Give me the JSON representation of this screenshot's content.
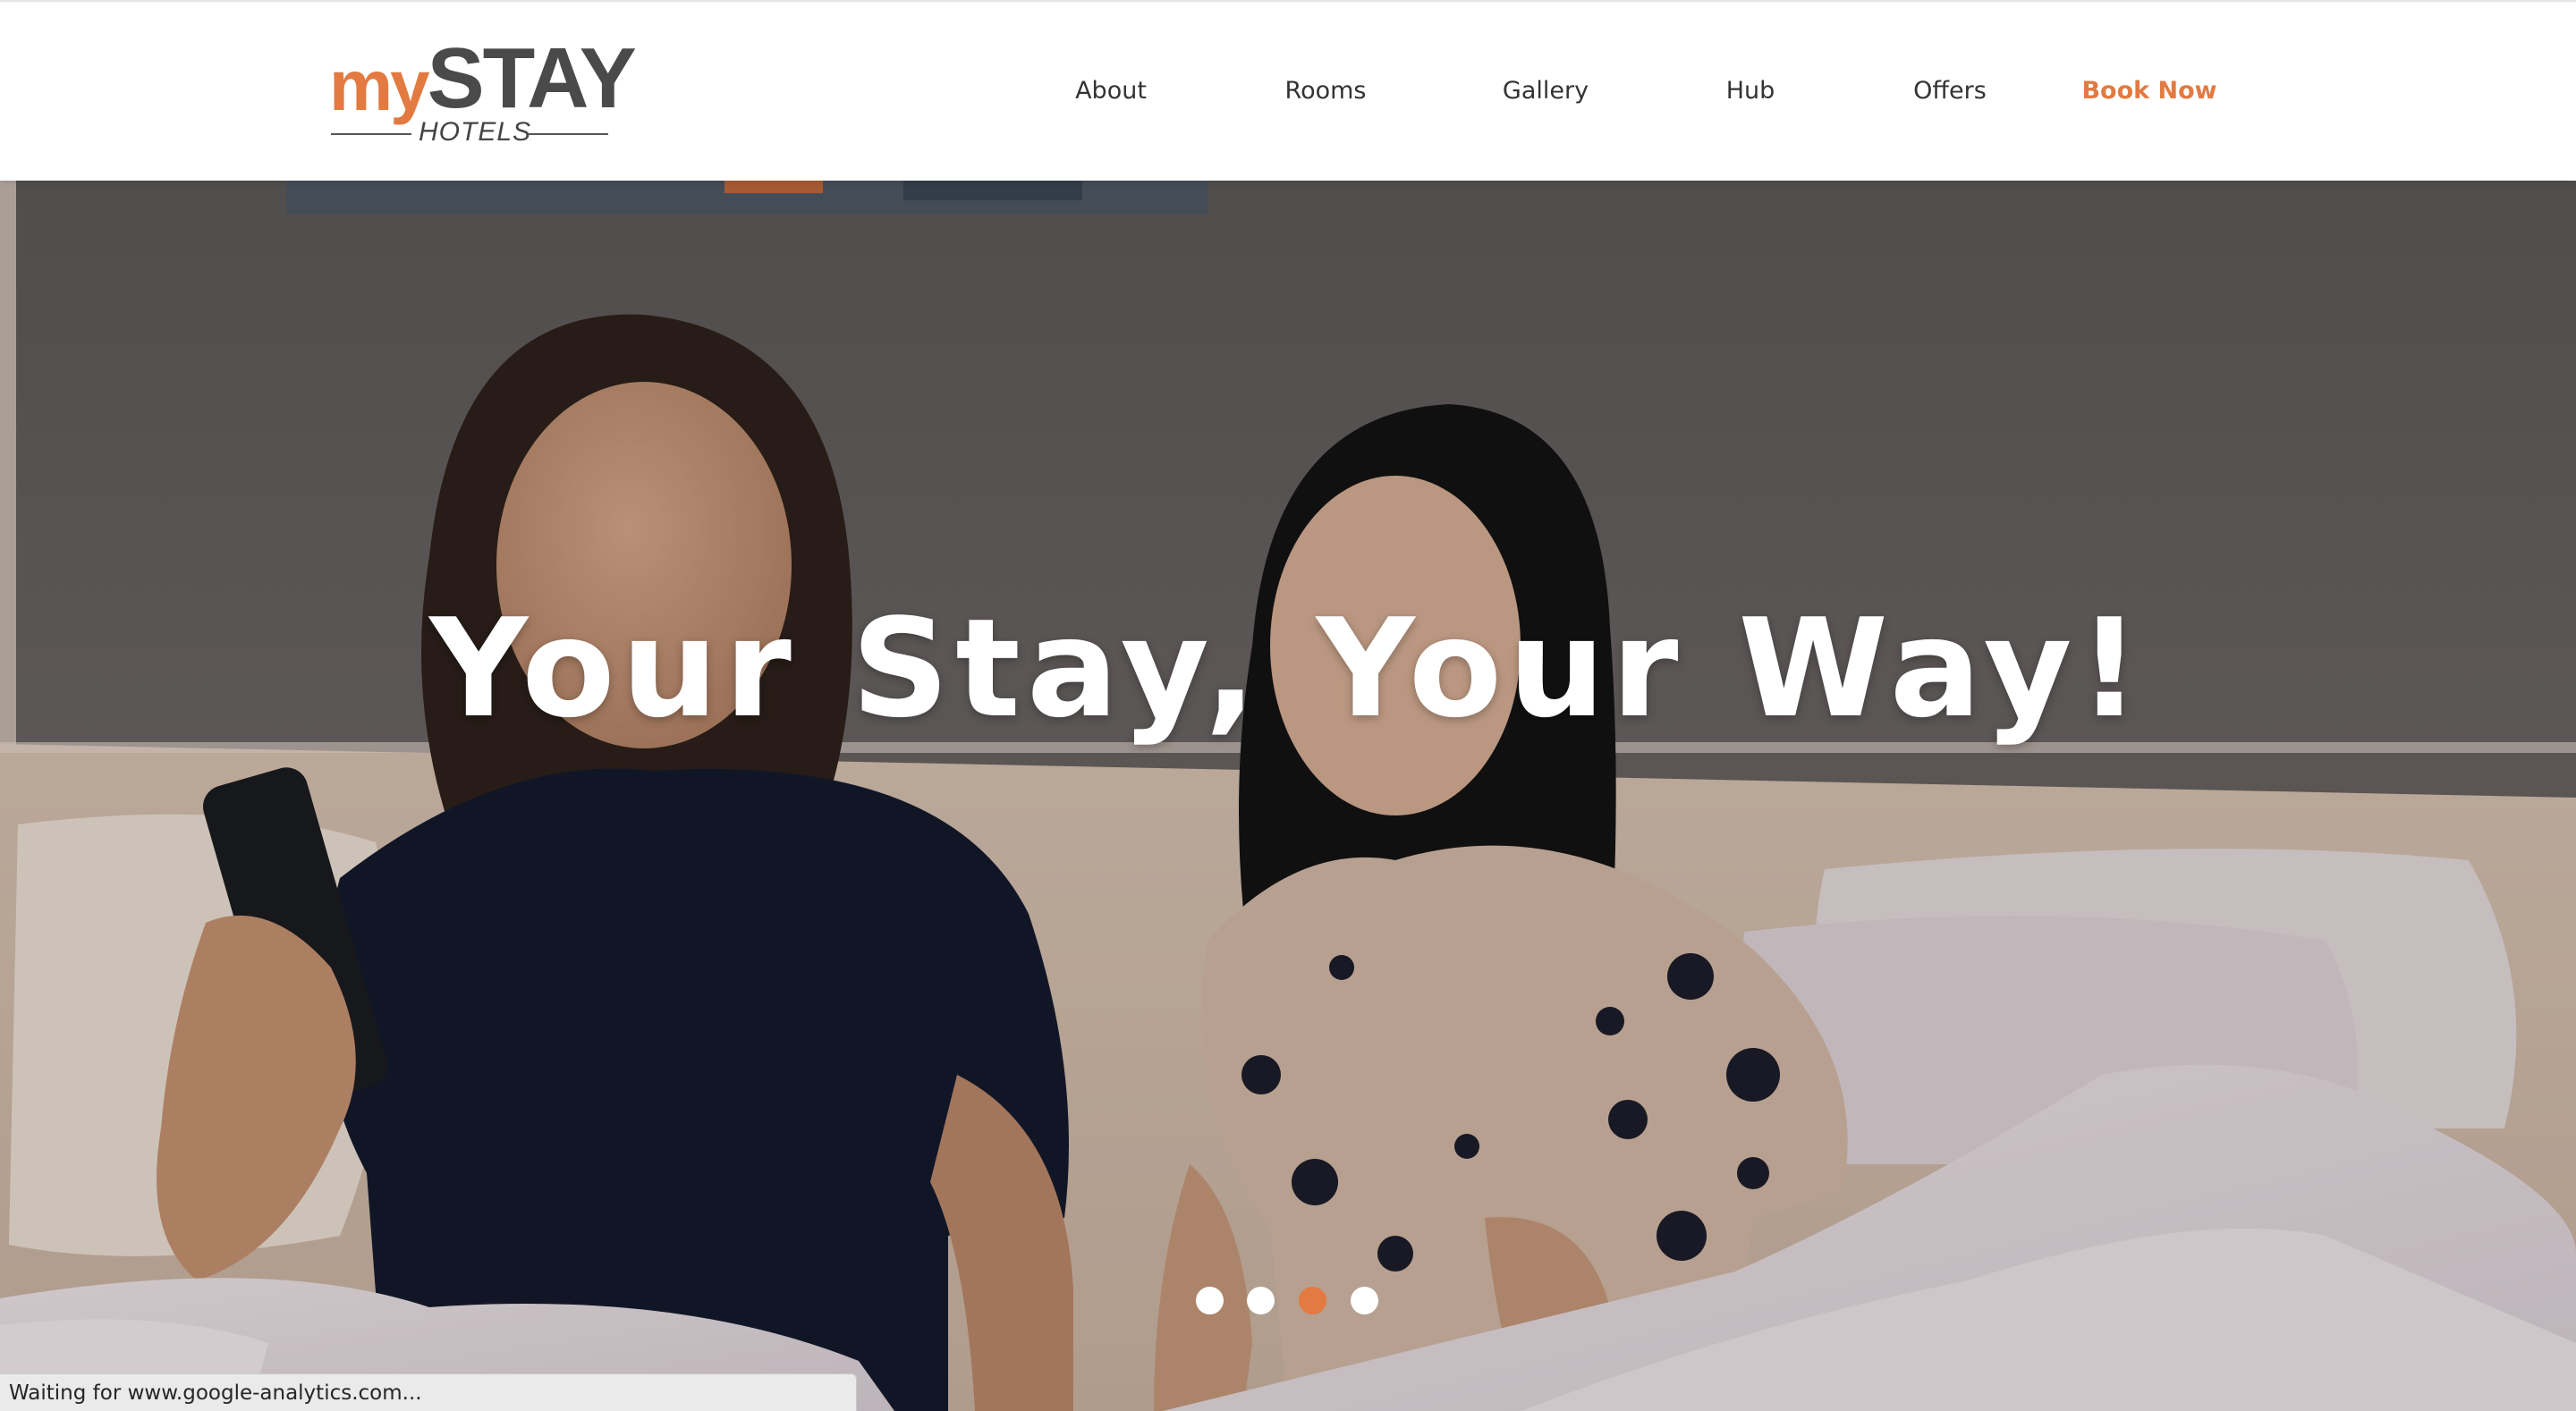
{
  "colors": {
    "brand_orange": "#e27a41",
    "dot_inactive": "#ffffff",
    "dot_active": "#e27a41"
  },
  "logo": {
    "my": "my",
    "stay": "STAY",
    "hotels": "HOTELS"
  },
  "nav": {
    "items": [
      {
        "label": "About"
      },
      {
        "label": "Rooms"
      },
      {
        "label": "Gallery"
      },
      {
        "label": "Hub"
      },
      {
        "label": "Offers"
      }
    ],
    "book_now": "Book Now"
  },
  "hero": {
    "title": "Your Stay, Your Way!",
    "image_icon": "hero-photo-two-women-on-hotel-bed",
    "slides": {
      "count": 4,
      "active_index": 2
    }
  },
  "status_bar": {
    "text": "Waiting for www.google-analytics.com..."
  }
}
